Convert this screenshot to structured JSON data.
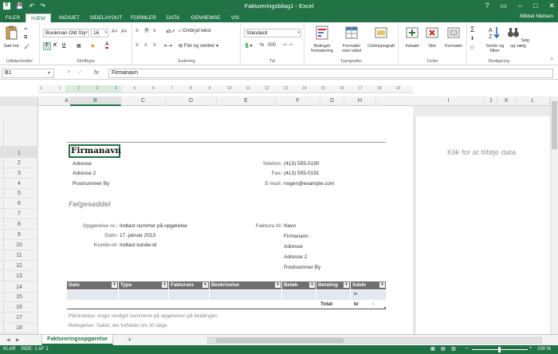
{
  "window": {
    "title": "Faktureringsbilag1 - Excel",
    "user": "Mikkel Nielsen"
  },
  "qat": {
    "save": "💾",
    "undo": "↶",
    "redo": "↷"
  },
  "window_controls": {
    "help": "?",
    "ribbon_opts": "▭",
    "minimize": "–",
    "maximize": "□",
    "close": "✕"
  },
  "tabs": [
    "FILER",
    "HJEM",
    "INDSÆT",
    "SIDELAYOUT",
    "FORMLER",
    "DATA",
    "GENNEMSE",
    "VIS"
  ],
  "ribbon": {
    "clipboard": {
      "label": "Udklipsholder",
      "paste": "Sæt ind"
    },
    "font": {
      "label": "Skrifttype",
      "name": "Bookman Old Sty",
      "size": "16",
      "bold": "F",
      "italic": "K",
      "underline": "U",
      "grow": "A˄",
      "shrink": "A˅"
    },
    "alignment": {
      "label": "Justering",
      "wrap": "Ombryd tekst",
      "merge": "Flet og centrer"
    },
    "number": {
      "label": "Tal",
      "format": "Standard",
      "percent": "%",
      "comma": "000"
    },
    "styles": {
      "label": "Typografier",
      "cond": "Betinget formatering",
      "table": "Formatér som tabel",
      "cell": "Celletypografi"
    },
    "cells": {
      "label": "Celler",
      "insert": "Indsæt",
      "delete": "Slet",
      "format": "Formatér"
    },
    "editing": {
      "label": "Redigering",
      "sigma": "Σ",
      "sort": "Sortér og filtrer",
      "find": "Søg og vælg"
    }
  },
  "formula_bar": {
    "cell": "B1",
    "fx": "fx",
    "value": "Firmanavn"
  },
  "columns": [
    "A",
    "B",
    "C",
    "D",
    "E",
    "F",
    "G",
    "H",
    "I",
    "J",
    "K",
    "L"
  ],
  "rows": [
    "1",
    "2",
    "3",
    "4",
    "5",
    "6",
    "7",
    "8",
    "9",
    "10",
    "11",
    "12",
    "13",
    "14",
    "15",
    "16",
    "17",
    "18"
  ],
  "ruler": [
    "1",
    "1",
    "2",
    "3",
    "4",
    "5",
    "6",
    "7",
    "8",
    "9",
    "10",
    "11",
    "12",
    "13",
    "14",
    "15",
    "16",
    "17",
    "18",
    "19"
  ],
  "invoice": {
    "company": "Firmanavn",
    "address_lines": [
      "Adresse",
      "Adresse 2",
      "Postnummer By"
    ],
    "phone_label": "Telefon:",
    "phone": "(413) 555-0190",
    "fax_label": "Fax:",
    "fax": "(413) 555-0191",
    "email_label": "E-mail:",
    "email": "nogen@example.com",
    "doc_title": "Følgeseddel",
    "order_label": "Opgørelse nr.:",
    "order_value": "Indtast nummer på opgørelse",
    "date_label": "Dato:",
    "date_value": "17. januar 2013",
    "customer_label": "Kunde-id:",
    "customer_value": "Indtast kunde-id",
    "bill_to_label": "Faktura til:",
    "bill_to": [
      "Navn",
      "Firmanavn",
      "Adresse",
      "Adresse 2",
      "Postnummer By"
    ],
    "table_headers": [
      "Dato",
      "Type",
      "Fakturanr.",
      "Beskrivelse",
      "Beløb",
      "Betaling",
      "Saldo"
    ],
    "currency": "kr",
    "total_label": "Total",
    "total_currency": "kr",
    "total_value": "-",
    "note1": "Påmindelse: Angiv venligst nummeret på opgørelsen på betalingen.",
    "note2": "Betingelser: Saldo, der forfalder om 30 dage."
  },
  "right_page": {
    "placeholder": "Klik for at tilføje data"
  },
  "sheet_tab": "Faktureringsopgørelse",
  "add_sheet": "+",
  "status": {
    "mode": "KLAR",
    "page": "SIDE: 1 AF 1",
    "zoom": "100 %"
  }
}
